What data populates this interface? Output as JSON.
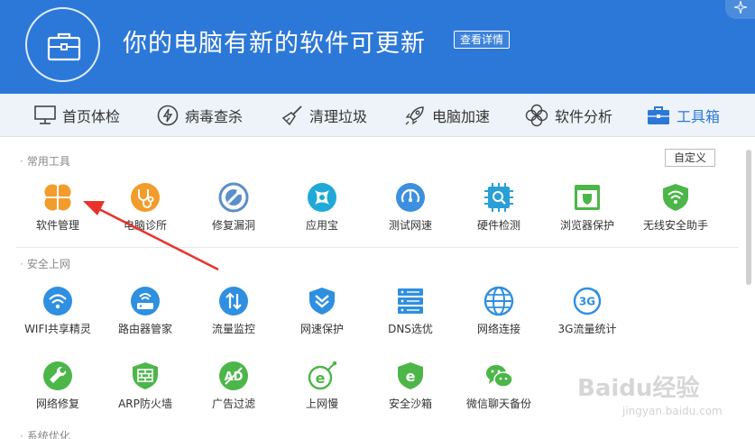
{
  "header": {
    "title": "你的电脑有新的软件可更新",
    "details_button": "查看详情"
  },
  "nav": {
    "items": [
      {
        "label": "首页体检",
        "icon": "monitor-icon"
      },
      {
        "label": "病毒查杀",
        "icon": "lightning-icon"
      },
      {
        "label": "清理垃圾",
        "icon": "broom-icon"
      },
      {
        "label": "电脑加速",
        "icon": "rocket-icon"
      },
      {
        "label": "软件分析",
        "icon": "fan-icon"
      },
      {
        "label": "工具箱",
        "icon": "toolbox-icon",
        "active": true
      }
    ]
  },
  "sections": {
    "common": {
      "title": "常用工具",
      "customize": "自定义",
      "tools": [
        {
          "label": "软件管理",
          "icon": "software-manager-icon",
          "color": "#f39c2b"
        },
        {
          "label": "电脑诊所",
          "icon": "stethoscope-icon",
          "color": "#f39c2b"
        },
        {
          "label": "修复漏洞",
          "icon": "repair-icon",
          "color": "#5b8fc7"
        },
        {
          "label": "应用宝",
          "icon": "app-store-icon",
          "color": "#1fa9d8"
        },
        {
          "label": "测试网速",
          "icon": "speed-test-icon",
          "color": "#3d8fe0"
        },
        {
          "label": "硬件检测",
          "icon": "hardware-chip-icon",
          "color": "#2a9fd6"
        },
        {
          "label": "浏览器保护",
          "icon": "browser-protect-icon",
          "color": "#4cb649"
        },
        {
          "label": "无线安全助手",
          "icon": "wifi-shield-icon",
          "color": "#4cb649"
        }
      ]
    },
    "internet": {
      "title": "安全上网",
      "tools": [
        {
          "label": "WIFI共享精灵",
          "icon": "wifi-share-icon",
          "color": "#2f8fe0"
        },
        {
          "label": "路由器管家",
          "icon": "router-icon",
          "color": "#2f8fe0"
        },
        {
          "label": "流量监控",
          "icon": "traffic-monitor-icon",
          "color": "#2f8fe0"
        },
        {
          "label": "网速保护",
          "icon": "speed-protect-icon",
          "color": "#2f8fe0"
        },
        {
          "label": "DNS选优",
          "icon": "dns-server-icon",
          "color": "#2f8fe0"
        },
        {
          "label": "网络连接",
          "icon": "globe-icon",
          "color": "#2f8fe0"
        },
        {
          "label": "3G流量统计",
          "icon": "3g-icon",
          "color": "#2f8fe0"
        }
      ],
      "tools_row2": [
        {
          "label": "网络修复",
          "icon": "wrench-icon",
          "color": "#4cb649"
        },
        {
          "label": "ARP防火墙",
          "icon": "firewall-icon",
          "color": "#4cb649"
        },
        {
          "label": "广告过滤",
          "icon": "ad-filter-icon",
          "color": "#4cb649"
        },
        {
          "label": "上网慢",
          "icon": "slow-net-icon",
          "color": "#4cb649"
        },
        {
          "label": "安全沙箱",
          "icon": "sandbox-icon",
          "color": "#4cb649"
        },
        {
          "label": "微信聊天备份",
          "icon": "wechat-backup-icon",
          "color": "#4cb649"
        }
      ]
    },
    "optimize": {
      "title": "系统优化"
    }
  },
  "watermark": {
    "brand": "Baidu经验",
    "url": "jingyan.baidu.com"
  }
}
